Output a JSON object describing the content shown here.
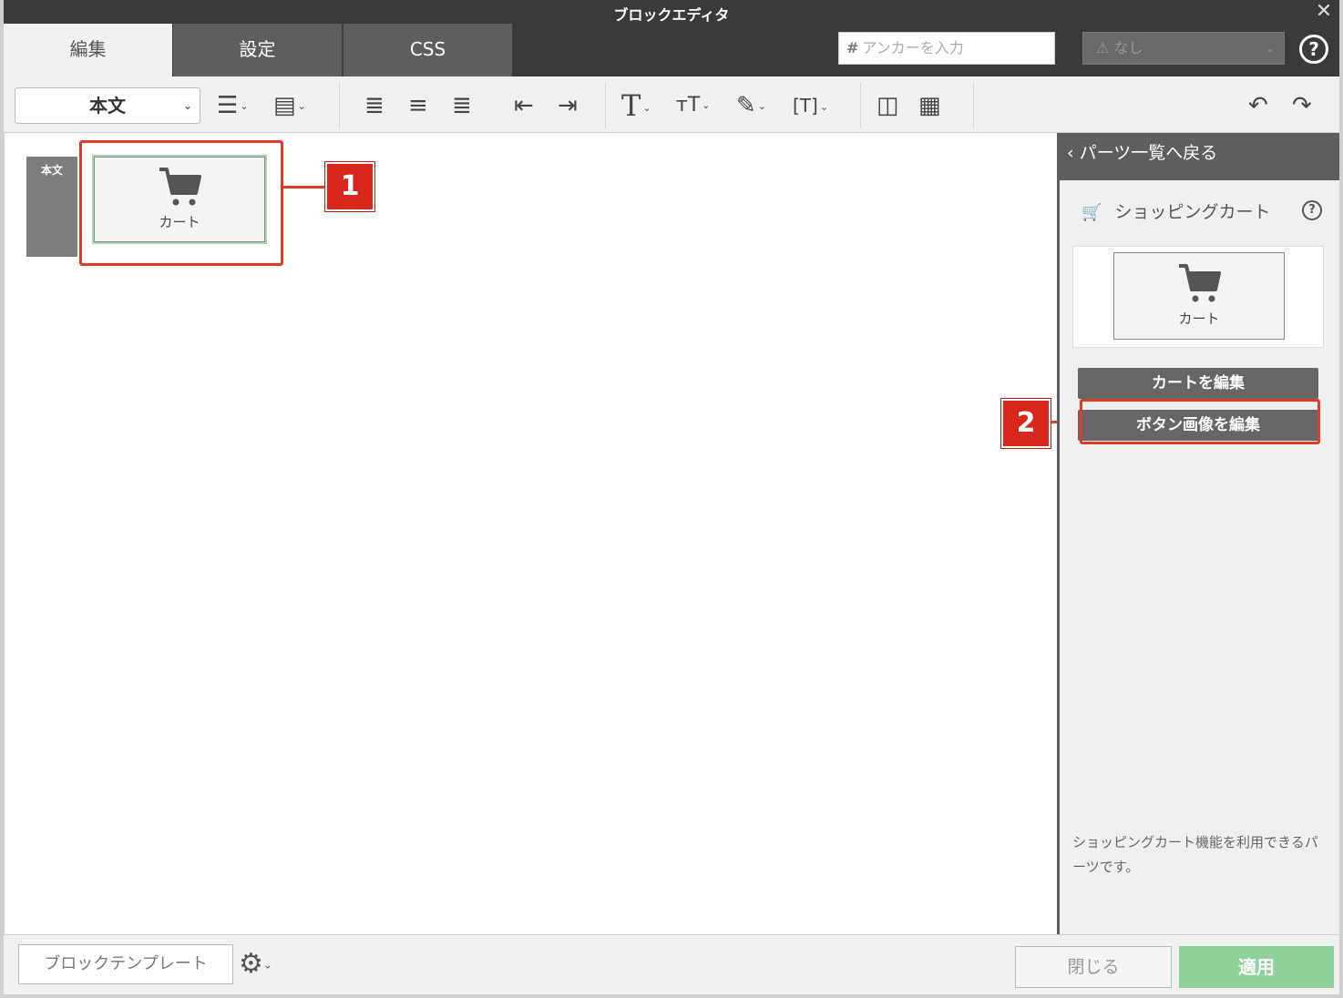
{
  "window": {
    "title": "ブロックエディタ",
    "close_glyph": "✕"
  },
  "tabs": [
    {
      "label": "編集"
    },
    {
      "label": "設定"
    },
    {
      "label": "CSS"
    }
  ],
  "anchor": {
    "hash": "#",
    "placeholder": "アンカーを入力"
  },
  "layout_select": {
    "value": "なし"
  },
  "toolbar": {
    "style_select": "本文",
    "icons": [
      "list-icon",
      "paragraph-format-icon",
      "align-left-icon",
      "align-center-icon",
      "align-right-icon",
      "outdent-icon",
      "indent-icon",
      "font-size-icon",
      "text-height-icon",
      "color-picker-icon",
      "text-frame-icon",
      "column-icon",
      "clear-format-icon",
      "undo-icon",
      "redo-icon"
    ]
  },
  "canvas": {
    "block_label": "本文",
    "cart_part_label": "カート",
    "callout_1": "1",
    "callout_2": "2"
  },
  "panel": {
    "back_link": "パーツ一覧へ戻る",
    "title": "ショッピングカート",
    "help": "?",
    "preview_label": "カート",
    "edit_cart_button": "カートを編集",
    "edit_button_image_button": "ボタン画像を編集",
    "description": "ショッピングカート機能を利用できるパーツです。"
  },
  "footer": {
    "template_button": "ブロックテンプレート",
    "close_button": "閉じる",
    "apply_button": "適用"
  },
  "colors": {
    "dark": "#3a3a3a",
    "tab_inactive": "#5e5e5e",
    "callout": "#d8261c",
    "apply": "#8fd19a"
  }
}
